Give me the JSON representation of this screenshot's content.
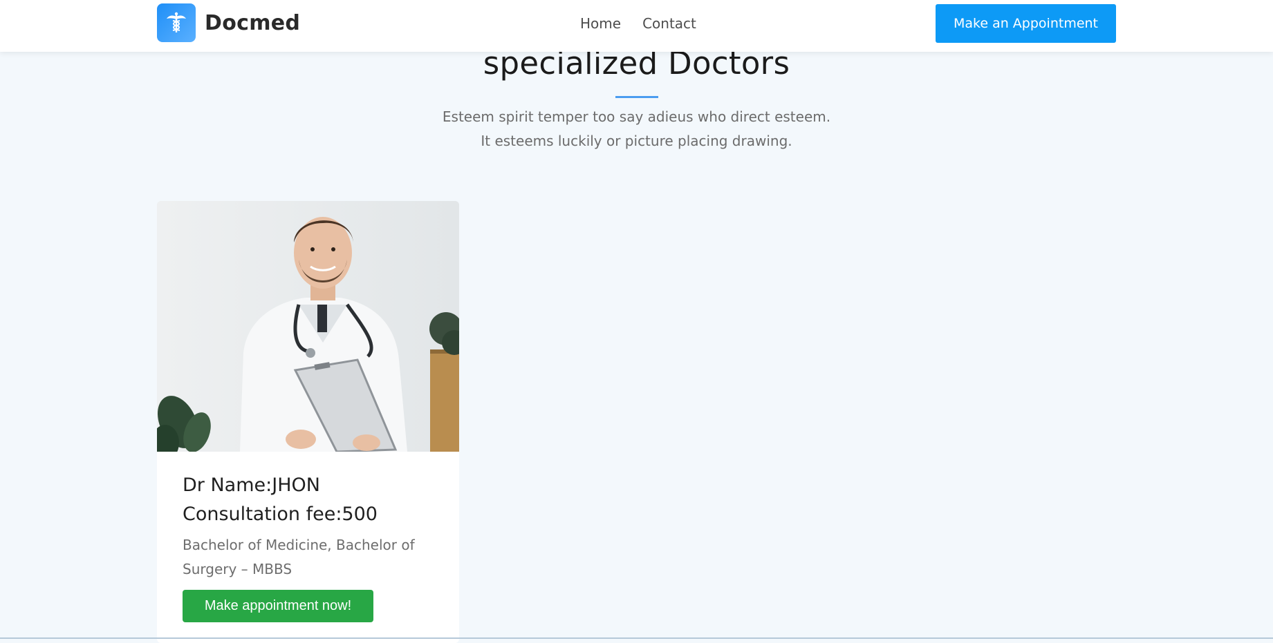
{
  "navbar": {
    "brand_name": "Docmed",
    "brand_icon": "caduceus-icon",
    "links": [
      "Home",
      "Contact"
    ],
    "cta_label": "Make an Appointment"
  },
  "section": {
    "title": "specialized Doctors",
    "subtitle_line1": "Esteem spirit temper too say adieus who direct esteem.",
    "subtitle_line2": "It esteems luckily or picture placing drawing."
  },
  "doctor_card": {
    "name": "Dr Name:JHON",
    "fee": "Consultation fee:500",
    "degree": "Bachelor of Medicine, Bachelor of Surgery – MBBS",
    "button_label": "Make appointment now!",
    "photo": "doctor-with-clipboard-photo"
  },
  "colors": {
    "accent": "#0d9af6",
    "success": "#28a745",
    "background": "#f3f8fc"
  }
}
